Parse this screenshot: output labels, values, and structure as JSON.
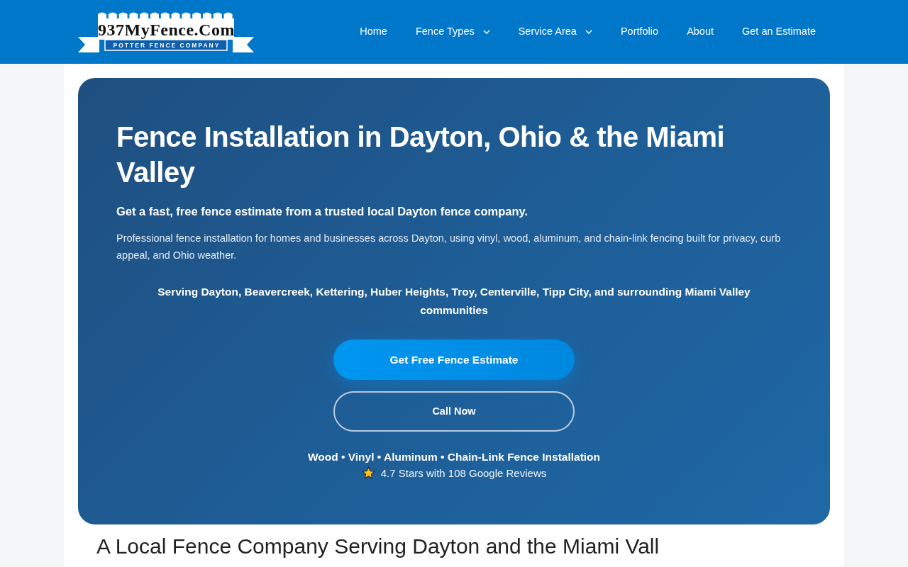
{
  "logo": {
    "title": "937MyFence.Com",
    "tagline": "POTTER FENCE COMPANY"
  },
  "nav": [
    {
      "label": "Home",
      "dropdown": false
    },
    {
      "label": "Fence Types",
      "dropdown": true
    },
    {
      "label": "Service Area",
      "dropdown": true
    },
    {
      "label": "Portfolio",
      "dropdown": false
    },
    {
      "label": "About",
      "dropdown": false
    },
    {
      "label": "Get an Estimate",
      "dropdown": false
    }
  ],
  "hero": {
    "title": "Fence Installation in Dayton, Ohio & the Miami Valley",
    "subtitle": "Get a fast, free fence estimate from a trusted local Dayton fence company.",
    "description": "Professional fence installation for homes and businesses across Dayton, using vinyl, wood, aluminum, and chain-link fencing built for privacy, curb appeal, and Ohio weather.",
    "service_area": "Serving Dayton, Beavercreek, Kettering, Huber Heights, Troy, Centerville, Tipp City, and surrounding Miami Valley communities",
    "buttons": [
      {
        "label": "Get Free Fence Estimate",
        "kind": "primary"
      },
      {
        "label": "Call Now",
        "kind": "outline"
      }
    ],
    "fence_types": "Wood • Vinyl • Aluminum • Chain-Link Fence Installation",
    "rating": "4.7 Stars with 108 Google Reviews"
  },
  "next_heading": "A Local Fence Company Serving Dayton and the Miami Vall"
}
